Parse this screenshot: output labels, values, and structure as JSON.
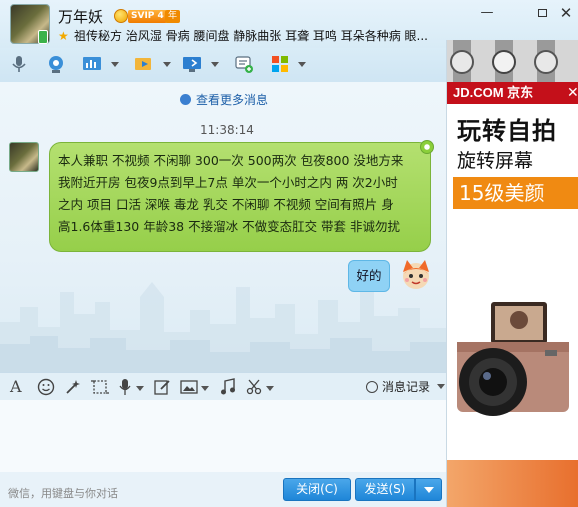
{
  "window": {
    "contact_name": "万年妖",
    "vip_badge": "SVIP 4",
    "year_badge": "年",
    "signature": "祖传秘方 治风湿 骨病 腰间盘 静脉曲张 耳聋 耳鸣 耳朵各种病 眼...",
    "minimize_glyph": "—",
    "close_glyph": "✕"
  },
  "toolbar": {
    "icons": [
      "microphone-icon",
      "video-camera-icon",
      "presentation-icon",
      "file-transfer-icon",
      "remote-desktop-icon",
      "add-chat-icon",
      "apps-icon"
    ]
  },
  "chat": {
    "more_messages": "查看更多消息",
    "timestamp": "11:38:14",
    "peer_message_lines": [
      "本人兼职 不视频 不闲聊 300一次 500两次 包夜800 没地方来",
      "我附近开房 包夜9点到早上7点 单次一个小时之内 两 次2小时",
      "之内 项目 口活 深喉 毒龙 乳交 不闲聊 不视频 空间有照片 身",
      "高1.6体重130 年龄38 不接溜冰 不做变态肛交 带套 非诚勿扰"
    ],
    "my_message": "好的"
  },
  "input_toolbar": {
    "font_glyph": "A",
    "history_label": "消息记录"
  },
  "bottom": {
    "hint": "微信，用键盘与你对话",
    "close_label": "关闭(C)",
    "send_label": "发送(S)"
  },
  "ad": {
    "brand": "JD.COM 京东",
    "close_glyph": "✕",
    "headline": "玩转自拍",
    "subline": "旋转屏幕",
    "beauty": "15级美颜"
  },
  "colors": {
    "peer_bubble": "#a6d85c",
    "my_bubble": "#8fd2f5",
    "button_blue": "#2b8fdd",
    "jd_red": "#c4101a",
    "ad_orange": "#f08a12"
  }
}
